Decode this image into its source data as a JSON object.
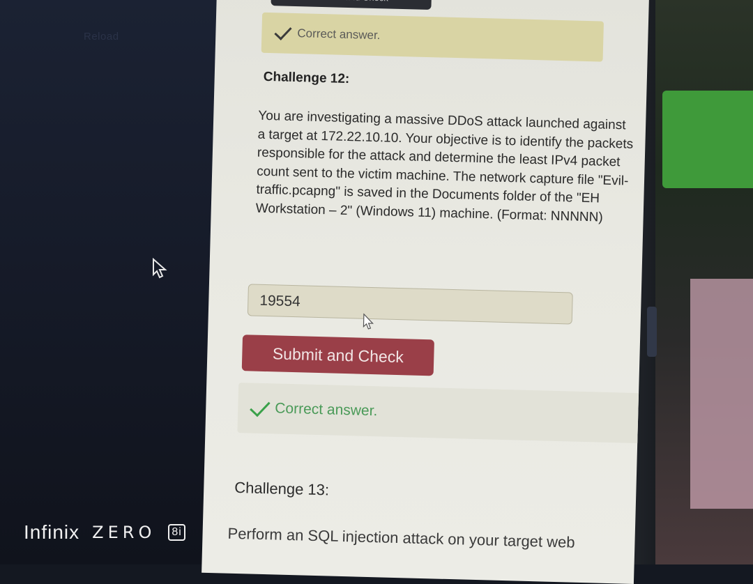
{
  "background": {
    "reload_ghost": "Reload"
  },
  "top_button": {
    "label": "Submit and Check"
  },
  "feedback_1": {
    "text": "Correct answer."
  },
  "challenge_12": {
    "title": "Challenge 12:",
    "text": "You are investigating a massive DDoS attack launched against a target at 172.22.10.10. Your objective is to identify the packets responsible for the attack and determine the least IPv4 packet count sent to the victim machine. The network capture file \"Evil-traffic.pcapng\" is saved in the Documents folder of the \"EH Workstation – 2\" (Windows 11) machine. (Format: NNNNN)",
    "answer_value": "19554",
    "submit_label": "Submit and Check",
    "feedback": "Correct answer."
  },
  "challenge_13": {
    "title": "Challenge 13:",
    "text": "Perform an SQL injection attack on your target web"
  },
  "watermark": {
    "brand": "Infinix",
    "model": "ZERO",
    "badge": "8i"
  },
  "colors": {
    "submit": "#9a3f48",
    "success": "#3aa14a",
    "feedback_bg": "#d9d4a4"
  },
  "icons": [
    "check-icon",
    "mouse-cursor-icon"
  ]
}
